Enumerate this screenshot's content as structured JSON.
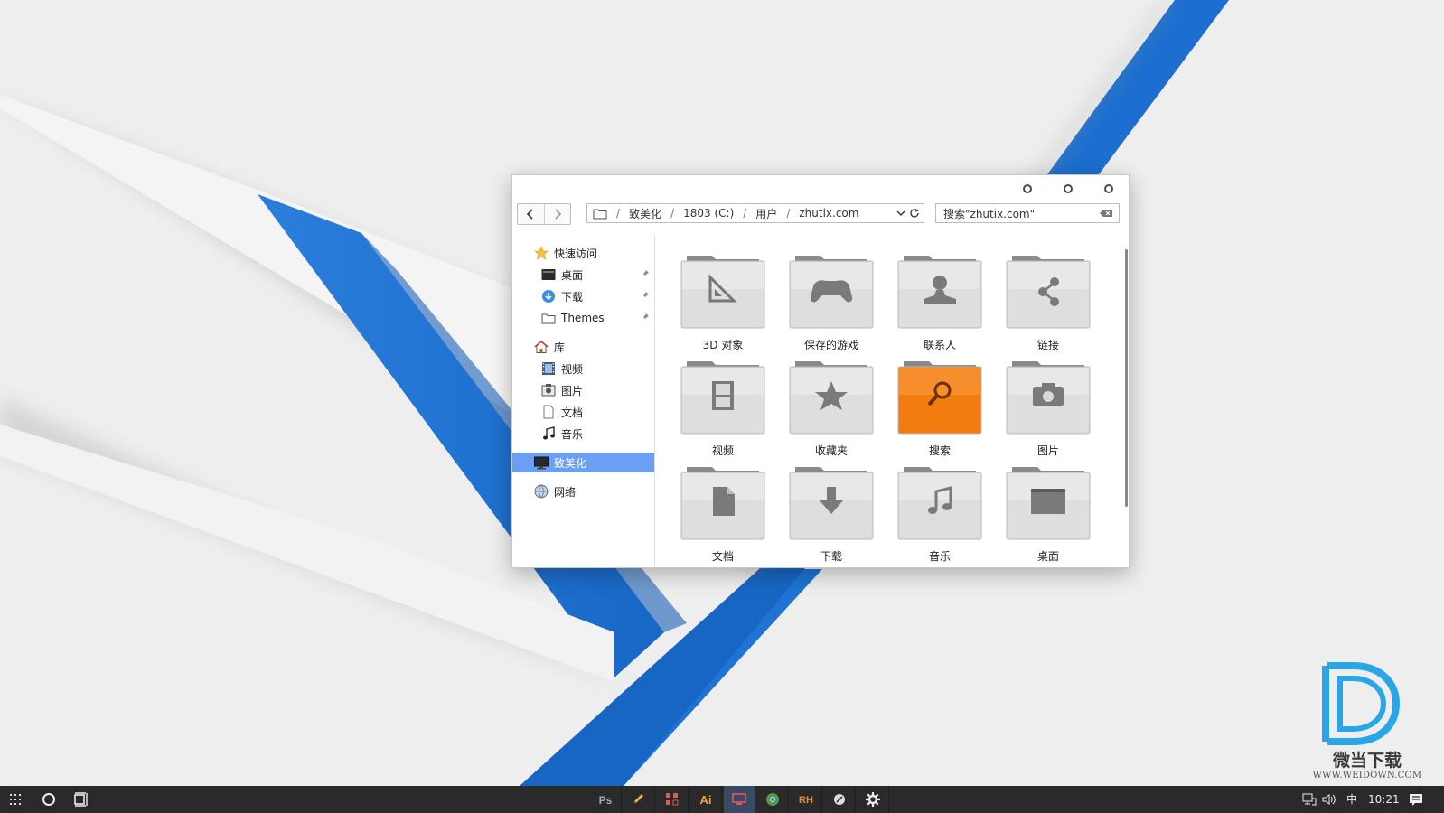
{
  "window": {
    "controls": [
      "minimize",
      "maximize",
      "close"
    ],
    "nav": {
      "back_icon": "chevron-left-icon",
      "forward_icon": "chevron-right-icon"
    },
    "address": {
      "crumbs": [
        "致美化",
        "1803 (C:)",
        "用户",
        "zhutix.com"
      ],
      "separator": "/"
    },
    "search": {
      "placeholder": "搜索\"zhutix.com\""
    }
  },
  "sidebar": {
    "quick_access": "快速访问",
    "quick_items": [
      {
        "label": "桌面",
        "icon": "desktop-icon",
        "pinned": true
      },
      {
        "label": "下载",
        "icon": "download-icon",
        "pinned": true
      },
      {
        "label": "Themes",
        "icon": "folder-icon",
        "pinned": true
      }
    ],
    "library": "库",
    "library_items": [
      {
        "label": "视频",
        "icon": "video-icon"
      },
      {
        "label": "图片",
        "icon": "picture-icon"
      },
      {
        "label": "文档",
        "icon": "document-icon"
      },
      {
        "label": "音乐",
        "icon": "music-icon"
      }
    ],
    "this_pc": "致美化",
    "network": "网络"
  },
  "folders": [
    {
      "label": "3D 对象",
      "icon": "set-square-icon"
    },
    {
      "label": "保存的游戏",
      "icon": "gamepad-icon"
    },
    {
      "label": "联系人",
      "icon": "person-icon"
    },
    {
      "label": "链接",
      "icon": "share-icon"
    },
    {
      "label": "视频",
      "icon": "film-icon"
    },
    {
      "label": "收藏夹",
      "icon": "star-icon"
    },
    {
      "label": "搜索",
      "icon": "search-icon",
      "highlight": true
    },
    {
      "label": "图片",
      "icon": "camera-icon"
    },
    {
      "label": "文档",
      "icon": "document-icon"
    },
    {
      "label": "下载",
      "icon": "download-arrow-icon"
    },
    {
      "label": "音乐",
      "icon": "music-icon"
    },
    {
      "label": "桌面",
      "icon": "desktop-icon"
    }
  ],
  "taskbar": {
    "apps": [
      {
        "label": "Ps",
        "icon": "photoshop-icon"
      },
      {
        "label": "",
        "icon": "pen-icon"
      },
      {
        "label": "",
        "icon": "grid-app-icon"
      },
      {
        "label": "Ai",
        "icon": "illustrator-icon"
      },
      {
        "label": "",
        "icon": "monitor-icon",
        "active": true
      },
      {
        "label": "",
        "icon": "chrome-icon"
      },
      {
        "label": "RH",
        "icon": "resource-hacker-icon"
      },
      {
        "label": "",
        "icon": "link-app-icon"
      },
      {
        "label": "",
        "icon": "gear-icon"
      }
    ],
    "ime": "中",
    "time": "10:21"
  },
  "watermark": {
    "title": "微当下载",
    "url": "WWW.WEIDOWN.COM"
  },
  "colors": {
    "accent_blue": "#1d78d6",
    "selection": "#6a9ff4",
    "folder_gray": "#d8d8d8",
    "folder_orange": "#f27c10",
    "taskbar": "#2a2a2a"
  }
}
